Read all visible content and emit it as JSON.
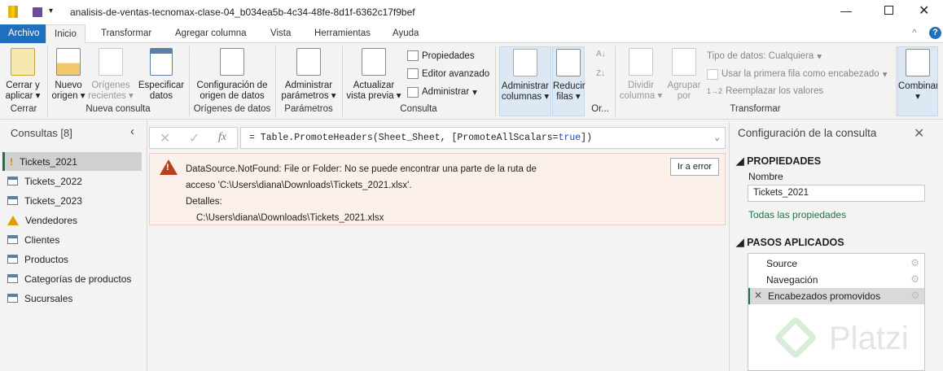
{
  "window": {
    "title": "analisis-de-ventas-tecnomax-clase-04_b034ea5b-4c34-48fe-8d1f-6362c17f9bef"
  },
  "tabs": [
    "Archivo",
    "Inicio",
    "Transformar",
    "Agregar columna",
    "Vista",
    "Herramientas",
    "Ayuda"
  ],
  "ribbon": {
    "cerrar_aplicar": "Cerrar y aplicar",
    "nuevo_origen": "Nuevo origen",
    "origenes_recientes": "Orígenes recientes",
    "especificar_datos": "Especificar datos",
    "configuracion_origen": "Configuración de origen de datos",
    "administrar_parametros": "Administrar parámetros",
    "actualizar_vista": "Actualizar vista previa",
    "propiedades": "Propiedades",
    "editor_avanzado": "Editor avanzado",
    "administrar": "Administrar",
    "administrar_columnas": "Administrar columnas",
    "reducir_filas": "Reducir filas",
    "dividir_columna": "Dividir columna",
    "agrupar_por": "Agrupar por",
    "tipo_datos": "Tipo de datos: Cualquiera",
    "primera_fila": "Usar la primera fila como encabezado",
    "reemplazar": "Reemplazar los valores",
    "combinar": "Combinar",
    "groups": {
      "cerrar": "Cerrar",
      "nueva_consulta": "Nueva consulta",
      "origenes": "Orígenes de datos",
      "parametros": "Parámetros",
      "consulta": "Consulta",
      "ordenar": "Or...",
      "transformar": "Transformar"
    }
  },
  "queries": {
    "header": "Consultas [8]",
    "items": [
      "Tickets_2021",
      "Tickets_2022",
      "Tickets_2023",
      "Vendedores",
      "Clientes",
      "Productos",
      "Categorías de productos",
      "Sucursales"
    ]
  },
  "formula": {
    "fx": "fx",
    "text": "= Table.PromoteHeaders(Sheet_Sheet, [PromoteAllScalars=",
    "keyword": "true",
    "end": "])"
  },
  "error": {
    "line1": "DataSource.NotFound: File or Folder: No se puede encontrar una parte de la ruta de",
    "line2": "acceso 'C:\\Users\\diana\\Downloads\\Tickets_2021.xlsx'.",
    "details_label": "Detalles:",
    "details": "C:\\Users\\diana\\Downloads\\Tickets_2021.xlsx",
    "button": "Ir a error"
  },
  "settings": {
    "title": "Configuración de la consulta",
    "properties": "PROPIEDADES",
    "name_label": "Nombre",
    "name_value": "Tickets_2021",
    "all_props": "Todas las propiedades",
    "steps_title": "PASOS APLICADOS",
    "steps": [
      "Source",
      "Navegación",
      "Encabezados promovidos"
    ]
  },
  "watermark": "Platzi"
}
